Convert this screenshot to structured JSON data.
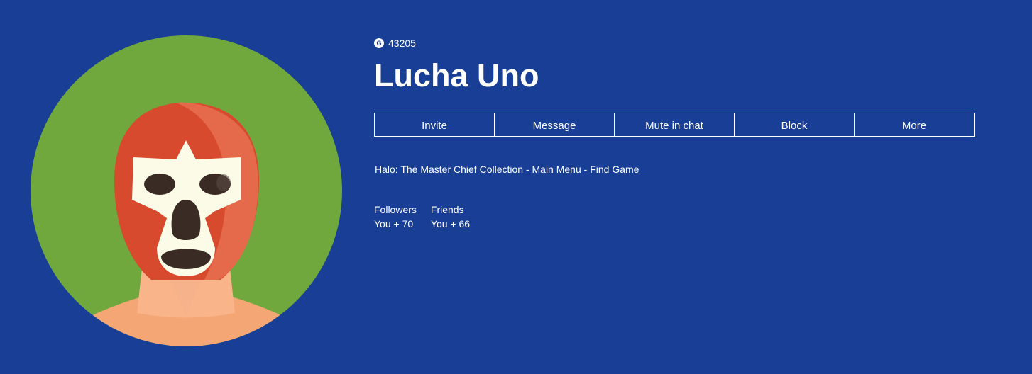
{
  "profile": {
    "gamerscore": "43205",
    "gamerscore_icon": "G",
    "gamertag": "Lucha Uno",
    "presence": "Halo: The Master Chief Collection - Main Menu - Find Game",
    "avatar_icon": "luchador-mask-avatar"
  },
  "actions": [
    {
      "label": "Invite"
    },
    {
      "label": "Message"
    },
    {
      "label": "Mute in chat"
    },
    {
      "label": "Block"
    },
    {
      "label": "More"
    }
  ],
  "stats": {
    "followers": {
      "label": "Followers",
      "value": "You + 70"
    },
    "friends": {
      "label": "Friends",
      "value": "You + 66"
    }
  },
  "colors": {
    "background": "#193e95",
    "avatar_bg": "#71a83e",
    "mask_red": "#d84a2d",
    "mask_highlight": "#e56a4c",
    "mask_white": "#fbfbe8",
    "skin": "#f4a674",
    "text": "#ffffff"
  }
}
